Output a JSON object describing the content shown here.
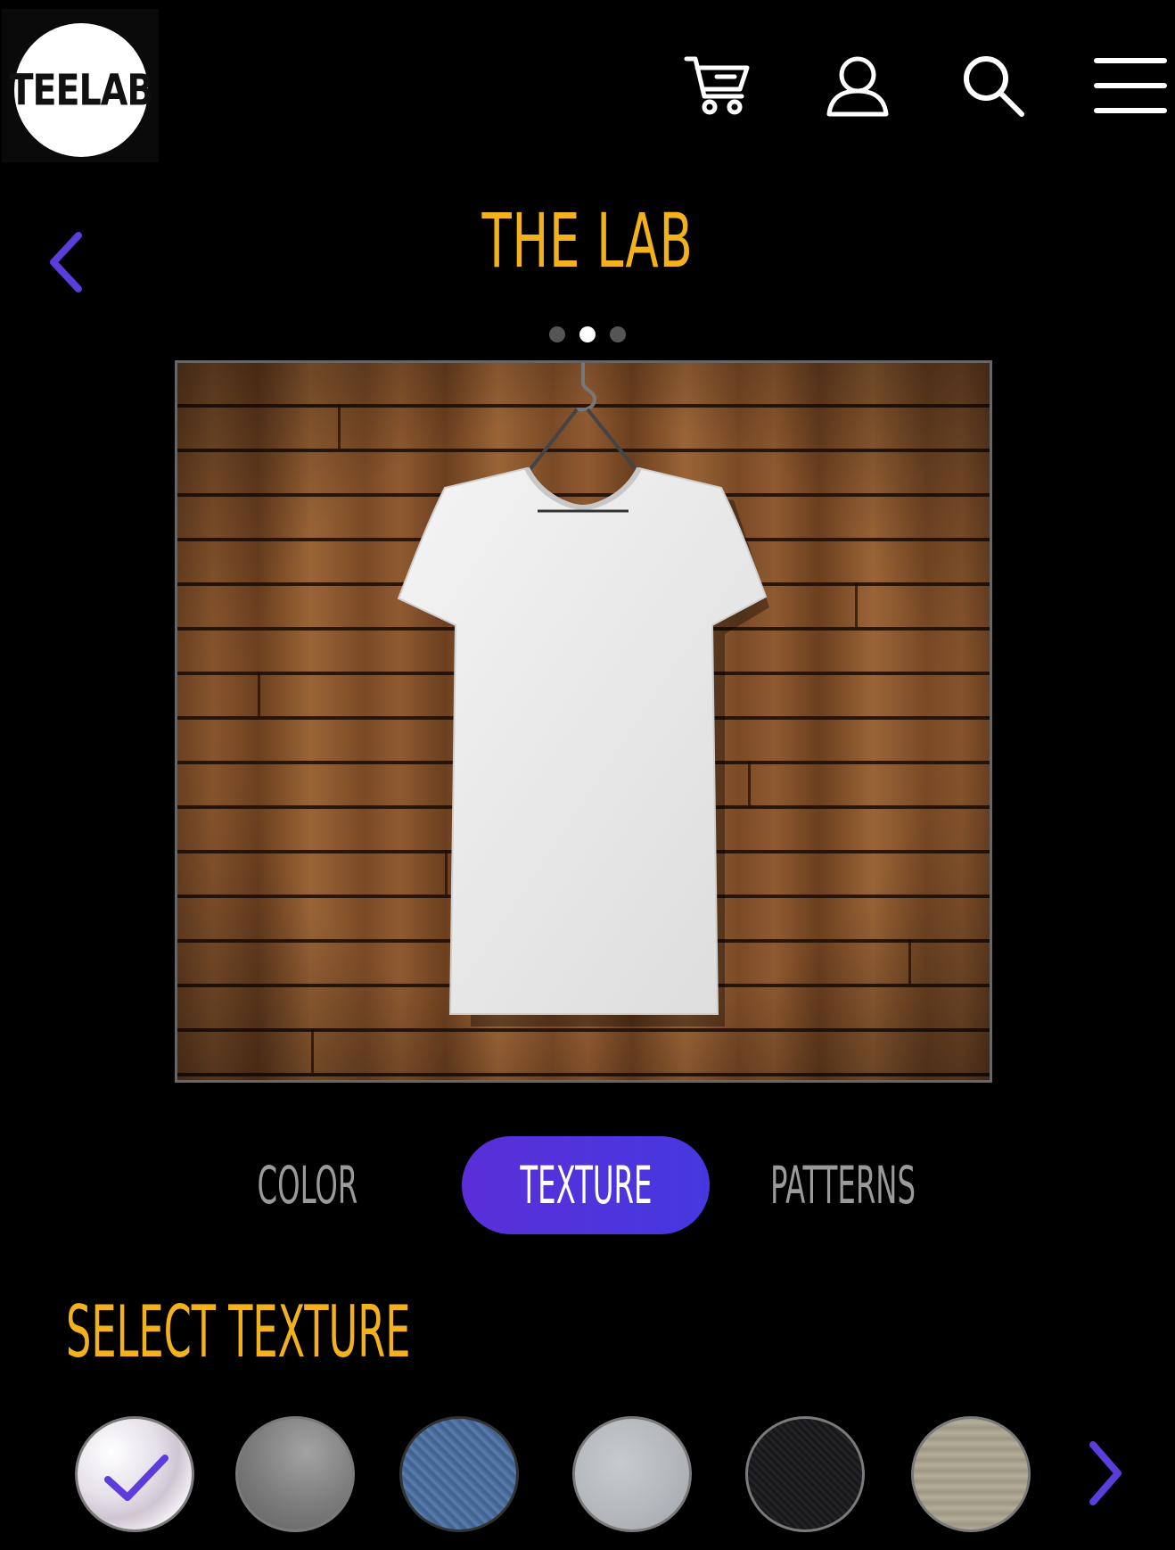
{
  "header": {
    "logo_text": "TEELAB",
    "icons": [
      "cart-icon",
      "user-icon",
      "search-icon",
      "menu-icon"
    ]
  },
  "page": {
    "title": "THE LAB",
    "carousel": {
      "pages": 3,
      "active_index": 1
    }
  },
  "tabs": [
    {
      "label": "COLOR",
      "active": false
    },
    {
      "label": "TEXTURE",
      "active": true
    },
    {
      "label": "PATTERNS",
      "active": false
    }
  ],
  "texture_section": {
    "title": "SELECT TEXTURE",
    "swatches": [
      {
        "name": "satin",
        "color": "#e9e4ee",
        "selected": true
      },
      {
        "name": "knit-gray",
        "color": "#8d8d8d",
        "selected": false
      },
      {
        "name": "denim-blue",
        "color": "#4d6f9f",
        "selected": false
      },
      {
        "name": "heather-light",
        "color": "#b9bcc1",
        "selected": false
      },
      {
        "name": "denim-black",
        "color": "#1a1a1c",
        "selected": false
      },
      {
        "name": "waffle-beige",
        "color": "#a79f8c",
        "selected": false
      }
    ]
  },
  "colors": {
    "accent_yellow": "#f3b21b",
    "accent_purple": "#5a2fd8",
    "background": "#000000"
  }
}
